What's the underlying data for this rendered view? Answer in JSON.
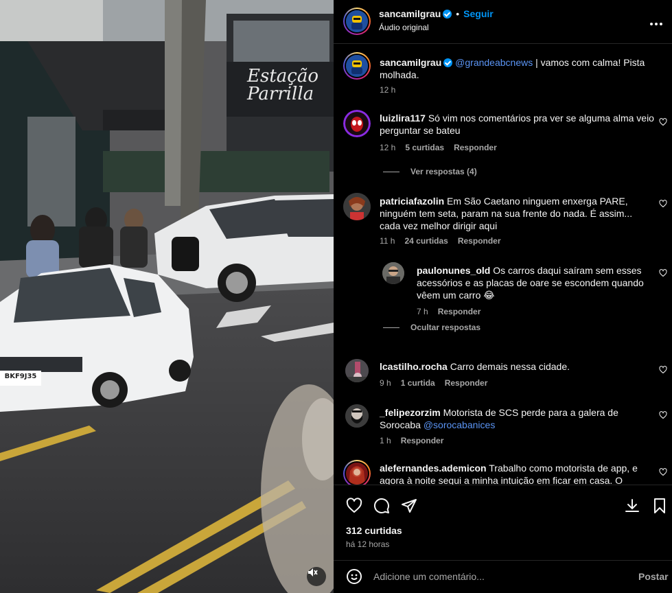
{
  "header": {
    "username": "sancamilgrau",
    "follow_label": "Seguir",
    "dot": "•",
    "audio": "Áudio original"
  },
  "caption": {
    "username": "sancamilgrau",
    "mention": "@grandeabcnews",
    "text": " | vamos com calma! Pista molhada.",
    "time": "12 h"
  },
  "comments": [
    {
      "username": "luizlira117",
      "text": " Só vim nos comentários pra ver se alguma alma veio perguntar se bateu",
      "time": "12 h",
      "likes": "5 curtidas",
      "reply": "Responder",
      "view_replies": "Ver respostas (4)"
    },
    {
      "username": "patriciafazolin",
      "text": " Em São Caetano ninguem enxerga PARE, ninguém tem seta, param na sua frente do nada. É assim... cada vez melhor dirigir aqui",
      "time": "11 h",
      "likes": "24 curtidas",
      "reply": "Responder",
      "replies": [
        {
          "username": "paulonunes_old",
          "text": " Os carros daqui saíram sem esses acessórios e as placas de oare se escondem quando vêem um carro 😂",
          "time": "7 h",
          "reply": "Responder"
        }
      ],
      "hide_replies": "Ocultar respostas"
    },
    {
      "username": "lcastilho.rocha",
      "text": " Carro demais nessa cidade.",
      "time": "9 h",
      "likes": "1 curtida",
      "reply": "Responder"
    },
    {
      "username": "_felipezorzim",
      "text": " Motorista de SCS perde para a galera de Sorocaba ",
      "mention": "@sorocabanices",
      "time": "1 h",
      "reply": "Responder"
    },
    {
      "username": "alefernandes.ademicon",
      "text": " Trabalho como motorista de app, e agora à noite segui a minha intuição em ficar em casa. O"
    }
  ],
  "footer": {
    "likes": "312 curtidas",
    "time_ago": "há 12 horas",
    "comment_placeholder": "Adicione um comentário...",
    "post_label": "Postar"
  },
  "video": {
    "shop_sign": "Estação Parrilla",
    "plate": "BKF9J35"
  },
  "colors": {
    "accent": "#0095f6",
    "background": "#000000",
    "secondary_text": "#a8a8a8"
  }
}
